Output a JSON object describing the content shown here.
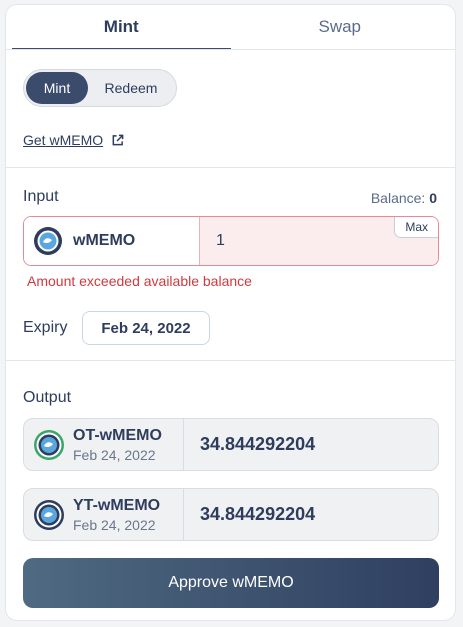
{
  "tabs": [
    {
      "label": "Mint",
      "active": true
    },
    {
      "label": "Swap",
      "active": false
    }
  ],
  "mode_toggle": {
    "mint": "Mint",
    "redeem": "Redeem",
    "selected": "Mint"
  },
  "get_link": {
    "label": "Get wMEMO",
    "icon": "external-link-icon"
  },
  "input": {
    "label": "Input",
    "balance_label": "Balance:",
    "balance_value": "0",
    "token": {
      "name": "wMEMO",
      "icon": "wmemo-token-icon"
    },
    "amount": "1",
    "max_label": "Max",
    "error": "Amount exceeded available balance"
  },
  "expiry": {
    "label": "Expiry",
    "value": "Feb 24, 2022"
  },
  "output": {
    "label": "Output",
    "items": [
      {
        "token": "OT-wMEMO",
        "date": "Feb 24, 2022",
        "value": "34.844292204",
        "icon": "ot-wmemo-token-icon"
      },
      {
        "token": "YT-wMEMO",
        "date": "Feb 24, 2022",
        "value": "34.844292204",
        "icon": "yt-wmemo-token-icon"
      }
    ]
  },
  "approve_button": {
    "label": "Approve wMEMO"
  },
  "colors": {
    "primary": "#3b4b6b",
    "error": "#d1393f",
    "error_bg": "#fbecee",
    "ot_ring": "#3aa66a",
    "yt_ring": "#2e3d5e"
  }
}
